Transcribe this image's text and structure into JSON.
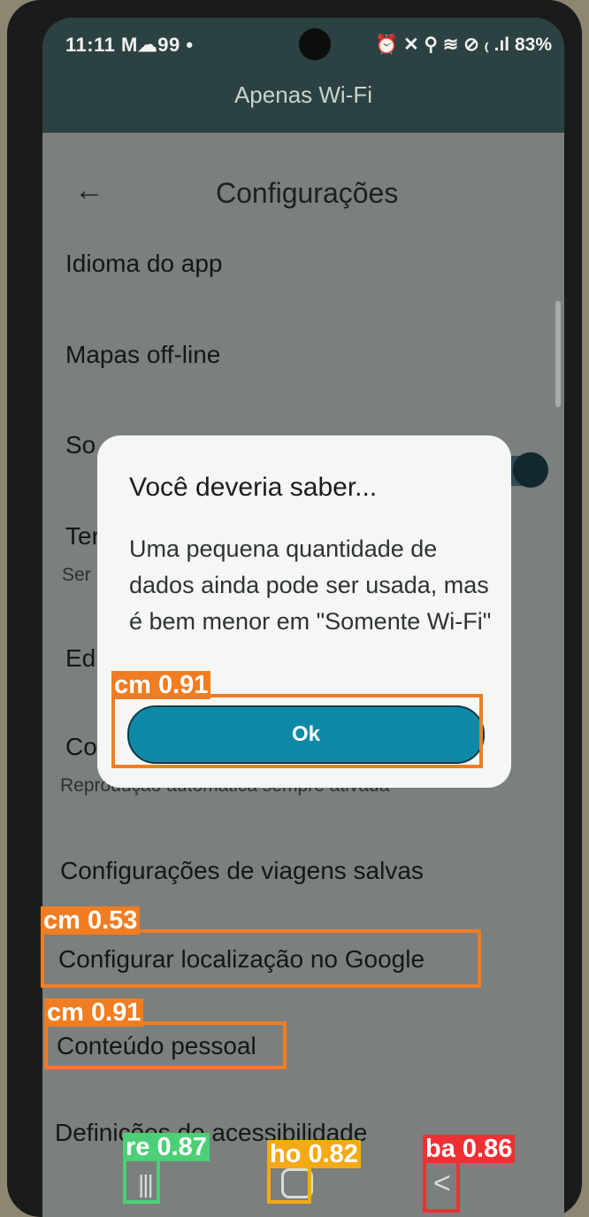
{
  "status_bar": {
    "time": "11:11",
    "left_icons": "M☁99 •",
    "right_icons": "⏰ ✕ ⚲ ≋ ⊘ ₍ .ıl",
    "battery": "83%"
  },
  "banner": {
    "text": "Apenas Wi-Fi"
  },
  "appbar": {
    "back_icon": "←",
    "title": "Configurações"
  },
  "settings": {
    "items": [
      {
        "label": "Idioma do app"
      },
      {
        "label": "Mapas off-line"
      },
      {
        "label": "So"
      },
      {
        "label": "Ter",
        "sub": "Ser"
      },
      {
        "label": "Edi"
      },
      {
        "label": "Co",
        "sub": "Reprodução automática sempre ativada"
      },
      {
        "label": "Configurações de viagens salvas"
      },
      {
        "label": "Configurar localização no Google"
      },
      {
        "label": "Conteúdo pessoal"
      },
      {
        "label": "Definições de acessibilidade"
      }
    ]
  },
  "dialog": {
    "title": "Você deveria saber...",
    "body": "Uma pequena quantidade de dados ainda pode ser usada, mas é bem menor em \"Somente Wi-Fi\"",
    "ok_label": "Ok"
  },
  "navbar": {
    "recent_icon": "|||",
    "back_icon": "<"
  },
  "detections": {
    "ok_button": {
      "label": "cm 0.91",
      "color": "#f07d22"
    },
    "location_item": {
      "label": "cm 0.53",
      "color": "#f07d22"
    },
    "personal_item": {
      "label": "cm 0.91",
      "color": "#f07d22"
    },
    "recent_button": {
      "label": "re 0.87",
      "color": "#4ccf77"
    },
    "home_button": {
      "label": "ho 0.82",
      "color": "#f4a916"
    },
    "back_button": {
      "label": "ba 0.86",
      "color": "#ee3035"
    }
  }
}
